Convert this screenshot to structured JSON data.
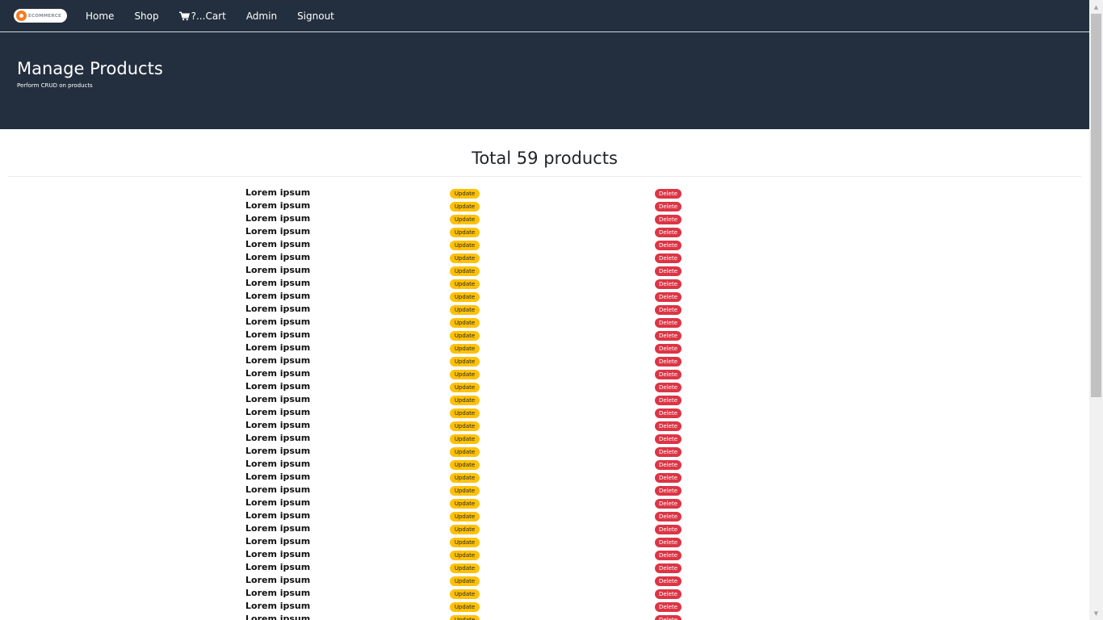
{
  "navbar": {
    "brand_text": "ECOMMERCE",
    "items": [
      {
        "label": "Home"
      },
      {
        "label": "Shop"
      },
      {
        "label": "?...Cart"
      },
      {
        "label": "Admin"
      },
      {
        "label": "Signout"
      }
    ]
  },
  "header": {
    "title": "Manage Products",
    "subtitle": "Perform CRUD on products"
  },
  "main": {
    "total_text": "Total 59 products",
    "update_label": "Update",
    "delete_label": "Delete",
    "products": [
      "Lorem ipsum",
      "Lorem ipsum",
      "Lorem ipsum",
      "Lorem ipsum",
      "Lorem ipsum",
      "Lorem ipsum",
      "Lorem ipsum",
      "Lorem ipsum",
      "Lorem ipsum",
      "Lorem ipsum",
      "Lorem ipsum",
      "Lorem ipsum",
      "Lorem ipsum",
      "Lorem ipsum",
      "Lorem ipsum",
      "Lorem ipsum",
      "Lorem ipsum",
      "Lorem ipsum",
      "Lorem ipsum",
      "Lorem ipsum",
      "Lorem ipsum",
      "Lorem ipsum",
      "Lorem ipsum",
      "Lorem ipsum",
      "Lorem ipsum",
      "Lorem ipsum",
      "Lorem ipsum",
      "Lorem ipsum",
      "Lorem ipsum",
      "Lorem ipsum",
      "Lorem ipsum",
      "Lorem ipsum",
      "Lorem ipsum",
      "Lorem ipsum"
    ]
  },
  "colors": {
    "navbar_bg": "#232f3e",
    "update_badge": "#ffc107",
    "delete_badge": "#dc3545",
    "brand_accent": "#f57c1f"
  },
  "icons": {
    "brand": "ecommerce-logo-icon",
    "cart": "cart-icon",
    "scroll_up": "scroll-up-arrow-icon",
    "scroll_down": "scroll-down-arrow-icon"
  }
}
